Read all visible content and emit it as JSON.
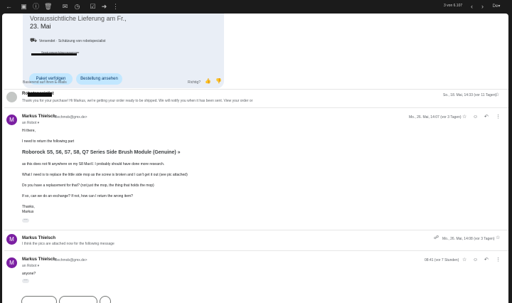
{
  "toolbar": {
    "icons": [
      "back-arrow-icon",
      "archive-icon",
      "report-spam-icon",
      "delete-icon",
      "mark-unread-icon",
      "snooze-icon",
      "add-task-icon",
      "move-to-icon",
      "more-icon"
    ],
    "counter": "3 von 6.107",
    "keyboard_label": "De"
  },
  "package": {
    "title_partial": "Voraussichtliche Lieferung am Fr.,",
    "date": "23. Mai",
    "shipped_text": "Versendet · Schätzung von robotspecialist",
    "tracking_label": "Sendungsverfolgungsnummer",
    "track_button": "Paket verfolgen",
    "order_button": "Bestellung ansehen",
    "based_on": "Basierend auf Ihren E-Mails",
    "correct_label": "Richtig?"
  },
  "messages": [
    {
      "sender": "Robotspecialist",
      "snippet": "Thank you for your purchase! Hi Markus, we're getting your order ready to be shipped. We will notify you when it has been sent. View your order or",
      "date": "So., 18. Mai, 14:33 (vor 11 Tagen)"
    },
    {
      "avatar": "M",
      "sender": "Markus Thielsch",
      "email": "<flechmob@gmx.de>",
      "to": "an Robot",
      "date": "Mo., 26. Mai, 14:07 (vor 3 Tagen)",
      "greeting": "Hi there,",
      "line1": "I need to return the following part",
      "product": "Roborock S5, S6, S7, S8, Q7 Series Side Brush Module (Genuine) »",
      "line2": "as this does not fit anywhere on my S8 MaxV. I probably should have done more research.",
      "line3": "What I need is to replace the little side mop as the screw is broken and I can't get it out (see pic attached)",
      "line4": "Do you have a replacement for that? (not just the mop, the thing that holds the mop)",
      "line5": "If so, can we do an exchange? If not, how can I return the wrong item?",
      "thanks": "Thanks,",
      "name": "Markus"
    },
    {
      "avatar": "M",
      "sender": "Markus Thielsch",
      "snippet": "I think the pics are attached now for the following message",
      "date": "Mo., 26. Mai, 14:08 (vor 3 Tagen)"
    },
    {
      "avatar": "M",
      "sender": "Markus Thielsch",
      "email": "<flechmob@gmx.de>",
      "to": "an Robot",
      "date": "08:41 (vor 7 Stunden)",
      "body": "anyone?"
    }
  ],
  "colors": {
    "avatar": "#7b1fa2",
    "pill": "#c2e7ff",
    "card": "#e9eef6"
  }
}
